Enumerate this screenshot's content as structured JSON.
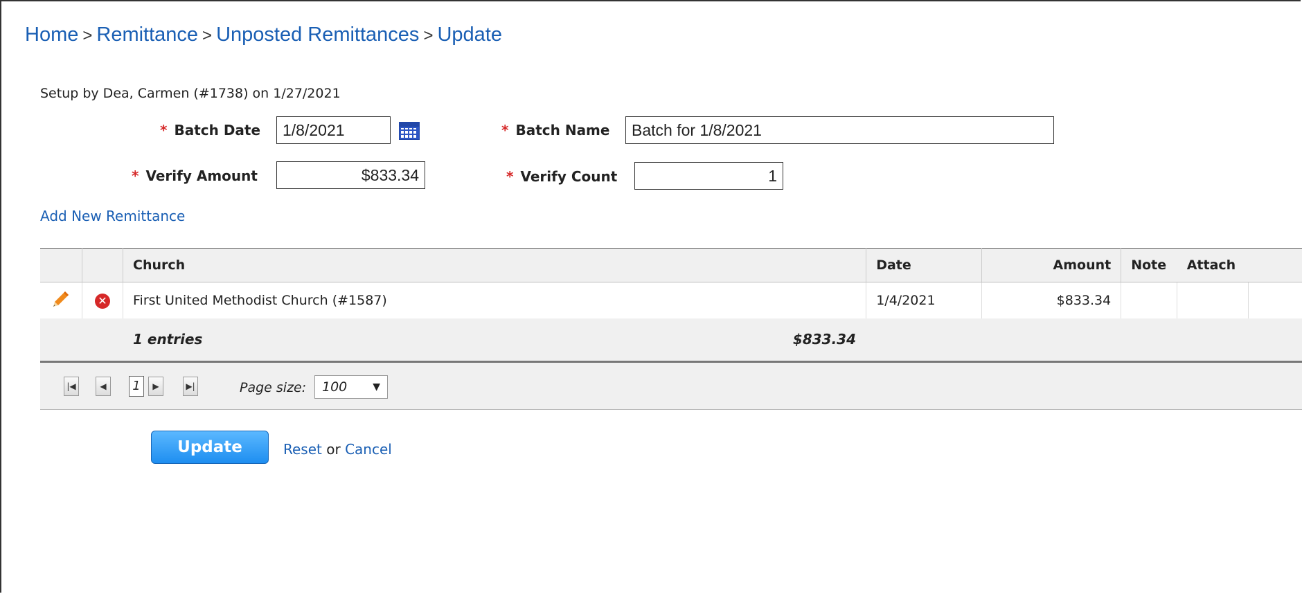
{
  "breadcrumb": [
    "Home",
    "Remittance",
    "Unposted Remittances",
    "Update"
  ],
  "breadcrumb_sep": ">",
  "setup_text": "Setup by Dea, Carmen (#1738) on 1/27/2021",
  "form": {
    "required_mark": "*",
    "batch_date_label": "Batch Date",
    "batch_date_value": "1/8/2021",
    "batch_name_label": "Batch Name",
    "batch_name_value": "Batch for 1/8/2021",
    "verify_amount_label": "Verify Amount",
    "verify_amount_value": "$833.34",
    "verify_count_label": "Verify Count",
    "verify_count_value": "1"
  },
  "add_link": "Add New Remittance",
  "table": {
    "headers": {
      "church": "Church",
      "date": "Date",
      "amount": "Amount",
      "note": "Note",
      "attach": "Attach"
    },
    "rows": [
      {
        "church": "First United Methodist Church (#1587)",
        "date": "1/4/2021",
        "amount": "$833.34",
        "note": "",
        "attach": ""
      }
    ],
    "footer": {
      "entries": "1 entries",
      "total": "$833.34"
    }
  },
  "pager": {
    "current_page": "1",
    "page_size_label": "Page size:",
    "page_size_value": "100"
  },
  "actions": {
    "update": "Update",
    "reset": "Reset",
    "or": "or",
    "cancel": "Cancel"
  },
  "icons": {
    "edit": "pencil-icon",
    "delete": "delete-circle-icon",
    "calendar": "calendar-icon"
  },
  "colors": {
    "link": "#1a5fb4",
    "required": "#d62828",
    "update_button": "#1e8ef0"
  }
}
